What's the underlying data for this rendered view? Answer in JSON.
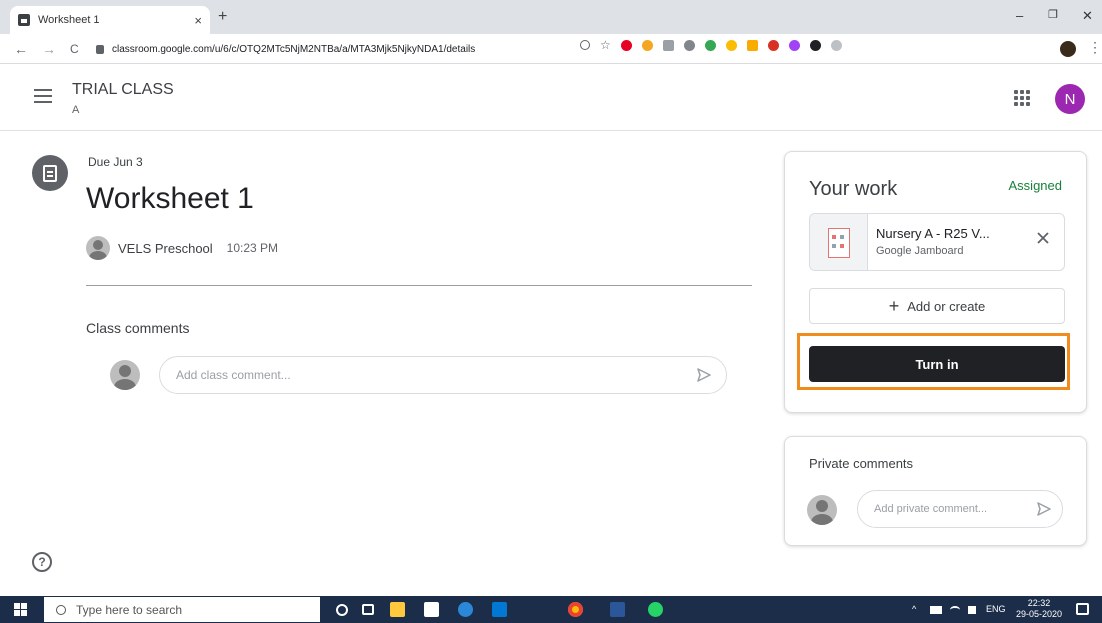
{
  "browser": {
    "tab_title": "Worksheet 1",
    "tab_close": "×",
    "new_tab": "+",
    "url": "classroom.google.com/u/6/c/OTQ2MTc5NjM2NTBa/a/MTA3Mjk5NjkyNDA1/details",
    "back": "←",
    "forward": "→",
    "reload": "C",
    "minimize": "–",
    "maximize": "❐",
    "close": "✕",
    "menu": "⋮"
  },
  "header": {
    "class_name": "TRIAL CLASS",
    "section": "A",
    "user_initial": "N"
  },
  "assignment": {
    "due": "Due Jun 3",
    "title": "Worksheet 1",
    "author": "VELS Preschool",
    "time": "10:23 PM",
    "comments_label": "Class comments",
    "comment_placeholder": "Add class comment..."
  },
  "your_work": {
    "title": "Your work",
    "status": "Assigned",
    "attachment_name": "Nursery A - R25 V...",
    "attachment_type": "Google Jamboard",
    "add_create_plus": "+",
    "add_create": "Add or create",
    "turn_in": "Turn in"
  },
  "private_comments": {
    "title": "Private comments",
    "placeholder": "Add private comment..."
  },
  "help": "?",
  "taskbar": {
    "search_placeholder": "Type here to search",
    "language": "ENG",
    "time": "22:32",
    "date": "29-05-2020"
  },
  "colors": {
    "accent_green": "#188038",
    "turn_in_bg": "#202124",
    "highlight": "#f08c1e",
    "avatar": "#9c27b0"
  }
}
